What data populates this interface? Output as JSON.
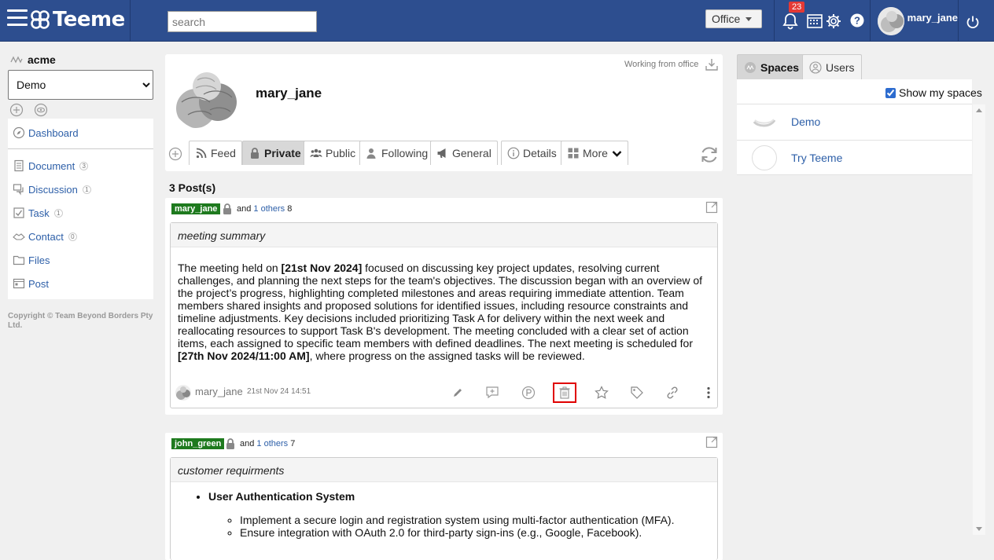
{
  "topbar": {
    "brand": "Teeme",
    "search_placeholder": "search",
    "office_label": "Office",
    "notification_count": "23",
    "user_name": "mary_jane"
  },
  "sidebar": {
    "org_name": "acme",
    "space_selected": "Demo",
    "items": [
      {
        "label": "Dashboard",
        "icon": "compass-icon",
        "count": ""
      },
      {
        "label": "Document",
        "icon": "document-icon",
        "count": "3"
      },
      {
        "label": "Discussion",
        "icon": "discussion-icon",
        "count": "1"
      },
      {
        "label": "Task",
        "icon": "task-icon",
        "count": "1"
      },
      {
        "label": "Contact",
        "icon": "contact-icon",
        "count": "0"
      },
      {
        "label": "Files",
        "icon": "folder-icon",
        "count": ""
      },
      {
        "label": "Post",
        "icon": "post-icon",
        "count": ""
      }
    ],
    "copyright": "Copyright © Team Beyond Borders Pty Ltd."
  },
  "profile": {
    "name": "mary_jane",
    "status": "Working from office",
    "tabs": [
      {
        "label": "Feed",
        "icon": "rss-icon"
      },
      {
        "label": "Private",
        "icon": "lock-icon"
      },
      {
        "label": "Public",
        "icon": "group-icon"
      },
      {
        "label": "Following",
        "icon": "user-follow-icon"
      },
      {
        "label": "General",
        "icon": "megaphone-icon"
      },
      {
        "label": "Details",
        "icon": "info-icon"
      },
      {
        "label": "More",
        "icon": "grid-icon"
      }
    ]
  },
  "posts": {
    "count_label": "3 Post(s)",
    "items": [
      {
        "author": "mary_jane",
        "and_text": "and",
        "others_link": "1 others",
        "others_count": "8",
        "title": "meeting summary",
        "body_parts": [
          "The meeting held on ",
          "[21st Nov 2024]",
          " focused on discussing key project updates, resolving current challenges, and planning the next steps for the team's objectives. The discussion began with an overview of the project’s progress, highlighting completed milestones and areas requiring immediate attention. Team members shared insights and proposed solutions for identified issues, including resource constraints and timeline adjustments. Key decisions included prioritizing Task A for delivery within the next week and reallocating resources to support Task B's development. The meeting concluded with a clear set of action items, each assigned to specific team members with defined deadlines. The next meeting is scheduled for ",
          "[27th Nov 2024/11:00 AM]",
          ", where progress on the assigned tasks will be reviewed."
        ],
        "footer_author": "mary_jane",
        "footer_time": "21st Nov 24 14:51"
      },
      {
        "author": "john_green",
        "and_text": "and",
        "others_link": "1 others",
        "others_count": "7",
        "title": "customer requirments",
        "list_heading": "User Authentication System",
        "list_items": [
          "Implement a secure login and registration system using multi-factor authentication (MFA).",
          "Ensure integration with OAuth 2.0 for third-party sign-ins (e.g., Google, Facebook)."
        ]
      }
    ]
  },
  "right_panel": {
    "tabs": [
      {
        "label": "Spaces",
        "icon": "spaces-icon"
      },
      {
        "label": "Users",
        "icon": "users-icon"
      }
    ],
    "show_my_spaces": "Show my spaces",
    "spaces": [
      {
        "name": "Demo"
      },
      {
        "name": "Try Teeme"
      }
    ]
  },
  "colors": {
    "topbar": "#2d4e8f",
    "link": "#2d5fa8",
    "author_tag": "#1e7a1e",
    "badge": "#e53935",
    "highlight": "#e00000"
  }
}
